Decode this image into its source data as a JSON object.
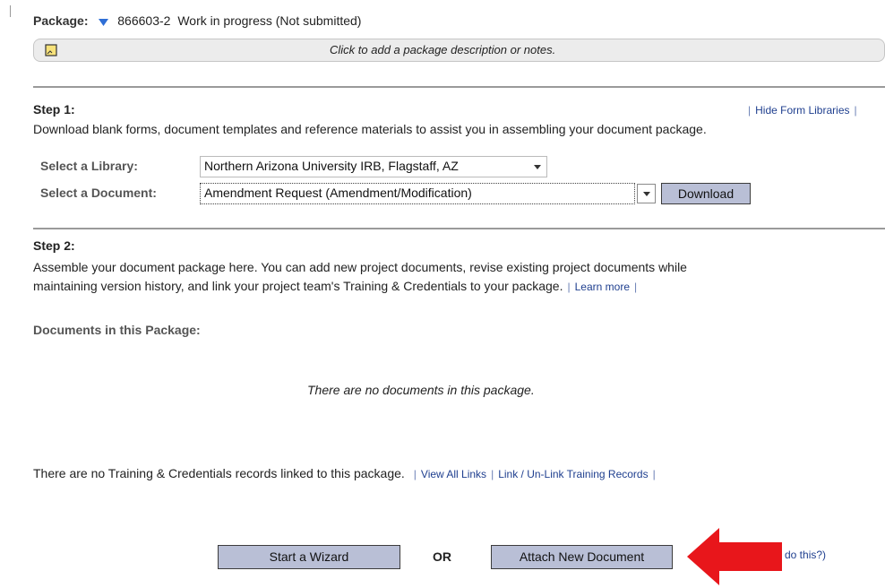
{
  "package": {
    "label": "Package:",
    "number": "866603-2",
    "status": "Work in progress (Not submitted)",
    "description_prompt": "Click to add a package description or notes."
  },
  "step1": {
    "title": "Step 1:",
    "hide_link": "Hide Form Libraries",
    "description": "Download blank forms, document templates and reference materials to assist you in assembling your document package.",
    "library_label": "Select a Library:",
    "library_value": "Northern Arizona University IRB, Flagstaff, AZ",
    "document_label": "Select a Document:",
    "document_value": "Amendment Request (Amendment/Modification)",
    "download_label": "Download"
  },
  "step2": {
    "title": "Step 2:",
    "description_line1": "Assemble your document package here. You can add new project documents, revise existing project documents while",
    "description_line2": "maintaining version history, and link your project team's Training & Credentials to your package.",
    "learn_more": "Learn more",
    "documents_heading": "Documents in this Package:",
    "empty_documents": "There are no documents in this package.",
    "no_training": "There are no Training & Credentials records linked to this package.",
    "view_all_links": "View All Links",
    "link_unlink": "Link / Un-Link Training Records"
  },
  "actions": {
    "wizard": "Start a Wizard",
    "or": "OR",
    "attach": "Attach New Document",
    "help_partial": "do this?)"
  },
  "colors": {
    "button_fill": "#b9bfd6",
    "link": "#1f3f8f",
    "arrow": "#e8161b",
    "note_bar": "#ececec"
  }
}
